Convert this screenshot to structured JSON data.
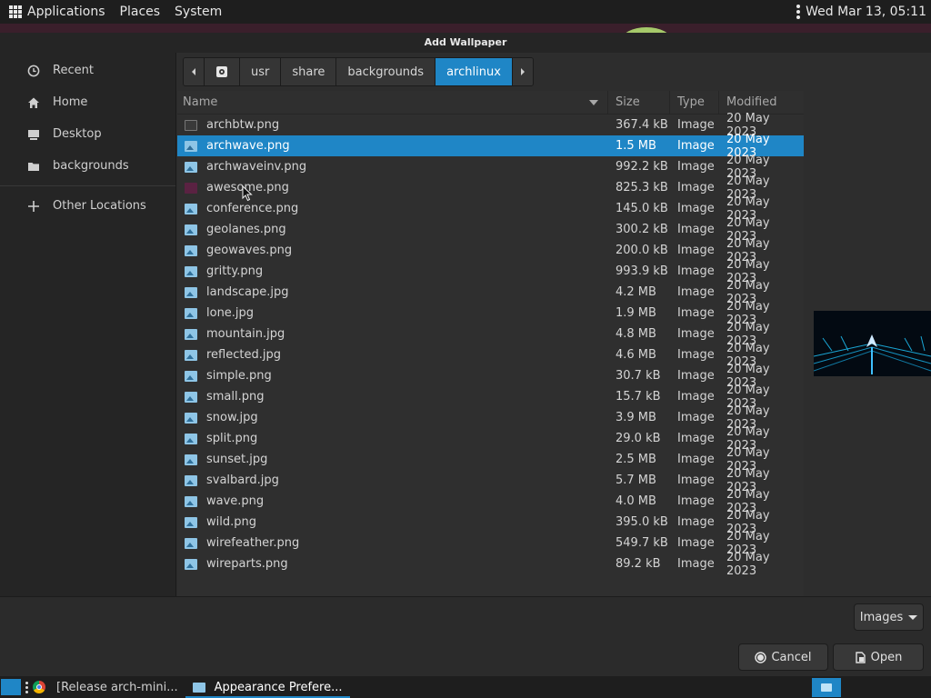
{
  "top_panel": {
    "menus": [
      "Applications",
      "Places",
      "System"
    ],
    "clock": "Wed Mar 13, 05:11"
  },
  "dialog": {
    "title": "Add Wallpaper",
    "sidebar": [
      {
        "label": "Recent",
        "icon": "clock-icon"
      },
      {
        "label": "Home",
        "icon": "home-icon"
      },
      {
        "label": "Desktop",
        "icon": "desktop-icon"
      },
      {
        "label": "backgrounds",
        "icon": "folder-icon"
      },
      {
        "label": "Other Locations",
        "icon": "plus-icon"
      }
    ],
    "path": [
      "usr",
      "share",
      "backgrounds",
      "archlinux"
    ],
    "columns": {
      "name": "Name",
      "size": "Size",
      "type": "Type",
      "modified": "Modified"
    },
    "files": [
      {
        "name": "archbtw.png",
        "size": "367.4 kB",
        "type": "Image",
        "modified": "20 May 2023",
        "icon": "dark"
      },
      {
        "name": "archwave.png",
        "size": "1.5 MB",
        "type": "Image",
        "modified": "20 May 2023",
        "icon": "img",
        "selected": true
      },
      {
        "name": "archwaveinv.png",
        "size": "992.2 kB",
        "type": "Image",
        "modified": "20 May 2023",
        "icon": "img"
      },
      {
        "name": "awesome.png",
        "size": "825.3 kB",
        "type": "Image",
        "modified": "20 May 2023",
        "icon": "pink"
      },
      {
        "name": "conference.png",
        "size": "145.0 kB",
        "type": "Image",
        "modified": "20 May 2023",
        "icon": "img"
      },
      {
        "name": "geolanes.png",
        "size": "300.2 kB",
        "type": "Image",
        "modified": "20 May 2023",
        "icon": "img"
      },
      {
        "name": "geowaves.png",
        "size": "200.0 kB",
        "type": "Image",
        "modified": "20 May 2023",
        "icon": "img"
      },
      {
        "name": "gritty.png",
        "size": "993.9 kB",
        "type": "Image",
        "modified": "20 May 2023",
        "icon": "img"
      },
      {
        "name": "landscape.jpg",
        "size": "4.2 MB",
        "type": "Image",
        "modified": "20 May 2023",
        "icon": "img"
      },
      {
        "name": "lone.jpg",
        "size": "1.9 MB",
        "type": "Image",
        "modified": "20 May 2023",
        "icon": "img"
      },
      {
        "name": "mountain.jpg",
        "size": "4.8 MB",
        "type": "Image",
        "modified": "20 May 2023",
        "icon": "img"
      },
      {
        "name": "reflected.jpg",
        "size": "4.6 MB",
        "type": "Image",
        "modified": "20 May 2023",
        "icon": "img"
      },
      {
        "name": "simple.png",
        "size": "30.7 kB",
        "type": "Image",
        "modified": "20 May 2023",
        "icon": "img"
      },
      {
        "name": "small.png",
        "size": "15.7 kB",
        "type": "Image",
        "modified": "20 May 2023",
        "icon": "img"
      },
      {
        "name": "snow.jpg",
        "size": "3.9 MB",
        "type": "Image",
        "modified": "20 May 2023",
        "icon": "img"
      },
      {
        "name": "split.png",
        "size": "29.0 kB",
        "type": "Image",
        "modified": "20 May 2023",
        "icon": "img"
      },
      {
        "name": "sunset.jpg",
        "size": "2.5 MB",
        "type": "Image",
        "modified": "20 May 2023",
        "icon": "img"
      },
      {
        "name": "svalbard.jpg",
        "size": "5.7 MB",
        "type": "Image",
        "modified": "20 May 2023",
        "icon": "img"
      },
      {
        "name": "wave.png",
        "size": "4.0 MB",
        "type": "Image",
        "modified": "20 May 2023",
        "icon": "img"
      },
      {
        "name": "wild.png",
        "size": "395.0 kB",
        "type": "Image",
        "modified": "20 May 2023",
        "icon": "img"
      },
      {
        "name": "wirefeather.png",
        "size": "549.7 kB",
        "type": "Image",
        "modified": "20 May 2023",
        "icon": "img"
      },
      {
        "name": "wireparts.png",
        "size": "89.2 kB",
        "type": "Image",
        "modified": "20 May 2023",
        "icon": "img"
      }
    ],
    "filter": "Images",
    "cancel_label": "Cancel",
    "open_label": "Open"
  },
  "taskbar": {
    "tasks": [
      "[Release arch-mini...",
      "Appearance Prefere..."
    ]
  },
  "colors": {
    "accent": "#1f86c6"
  }
}
